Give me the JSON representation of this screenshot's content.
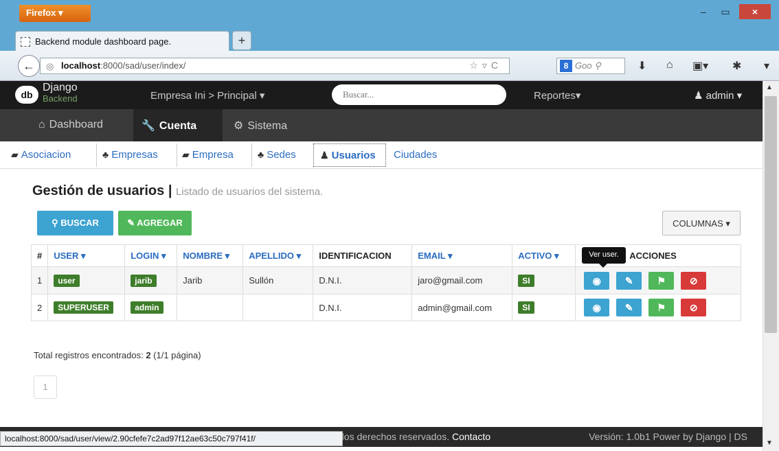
{
  "browser": {
    "app_button": "Firefox ▾",
    "tab_title": "Backend module dashboard page.",
    "new_tab": "+",
    "url_host": "localhost",
    "url_path": ":8000/sad/user/index/",
    "search_engine": "8",
    "search_placeholder": "Goo",
    "status_url": "localhost:8000/sad/user/view/2.90cfefe7c2ad97f12ae63c50c797f41f/"
  },
  "topnav": {
    "logo_badge": "db",
    "logo_title": "Django",
    "logo_subtitle": "Backend",
    "empresa_menu": "Empresa Ini > Principal ▾",
    "search_placeholder": "Buscar...",
    "reportes_menu": "Reportes▾",
    "user_menu": "admin ▾"
  },
  "subnav": {
    "dashboard": "Dashboard",
    "cuenta": "Cuenta",
    "sistema": "Sistema"
  },
  "tabs": {
    "asociacion": "Asociacion",
    "empresas": "Empresas",
    "empresa": "Empresa",
    "sedes": "Sedes",
    "usuarios": "Usuarios",
    "ciudades": "Ciudades"
  },
  "page": {
    "title": "Gestión de usuarios",
    "separator": " | ",
    "subtitle": "Listado de usuarios del sistema."
  },
  "toolbar": {
    "buscar": "BUSCAR",
    "agregar": "AGREGAR",
    "columnas": "COLUMNAS ▾"
  },
  "table": {
    "headers": {
      "num": "#",
      "user": "USER ▾",
      "login": "LOGIN ▾",
      "nombre": "NOMBRE ▾",
      "apellido": "APELLIDO ▾",
      "identificacion": "IDENTIFICACION",
      "email": "EMAIL ▾",
      "activo": "ACTIVO ▾",
      "acciones": "ACCIONES"
    },
    "rows": [
      {
        "num": "1",
        "user": "user",
        "login": "jarib",
        "nombre": "Jarib",
        "apellido": "Sullón",
        "identificacion": "D.N.I.",
        "email": "jaro@gmail.com",
        "activo": "SI"
      },
      {
        "num": "2",
        "user": "SUPERUSER",
        "login": "admin",
        "nombre": "",
        "apellido": "",
        "identificacion": "D.N.I.",
        "email": "admin@gmail.com",
        "activo": "SI"
      }
    ],
    "tooltip": "Ver user."
  },
  "summary": {
    "prefix": "Total registros encontrados: ",
    "count": "2",
    "suffix": " (1/1 página)"
  },
  "pager": {
    "page": "1"
  },
  "footer": {
    "left_text": "os los derechos reservados. ",
    "contact": "Contacto",
    "right_text": "Versión: 1.0b1 Power by Django | DS"
  },
  "colors": {
    "accent_blue": "#3da3d1",
    "accent_green": "#50b85a",
    "danger": "#d83a3a",
    "label_green": "#3e7d2a",
    "navbar": "#1b1b1b"
  }
}
